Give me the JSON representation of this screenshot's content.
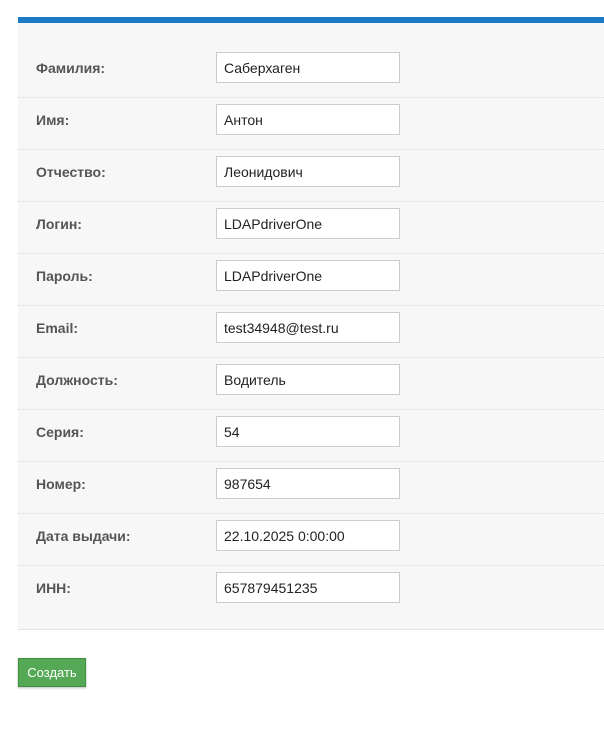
{
  "form": {
    "fields": [
      {
        "label": "Фамилия:",
        "value": "Саберхаген"
      },
      {
        "label": "Имя:",
        "value": "Антон"
      },
      {
        "label": "Отчество:",
        "value": "Леонидович"
      },
      {
        "label": "Логин:",
        "value": "LDAPdriverOne"
      },
      {
        "label": "Пароль:",
        "value": "LDAPdriverOne"
      },
      {
        "label": "Email:",
        "value": "test34948@test.ru"
      },
      {
        "label": "Должность:",
        "value": "Водитель"
      },
      {
        "label": "Серия:",
        "value": "54"
      },
      {
        "label": "Номер:",
        "value": "987654"
      },
      {
        "label": "Дата выдачи:",
        "value": "22.10.2025 0:00:00"
      },
      {
        "label": "ИНН:",
        "value": "657879451235"
      }
    ],
    "submit_label": "Создать"
  },
  "colors": {
    "accent_bar": "#1b7bc7",
    "submit_button": "#55a855"
  }
}
